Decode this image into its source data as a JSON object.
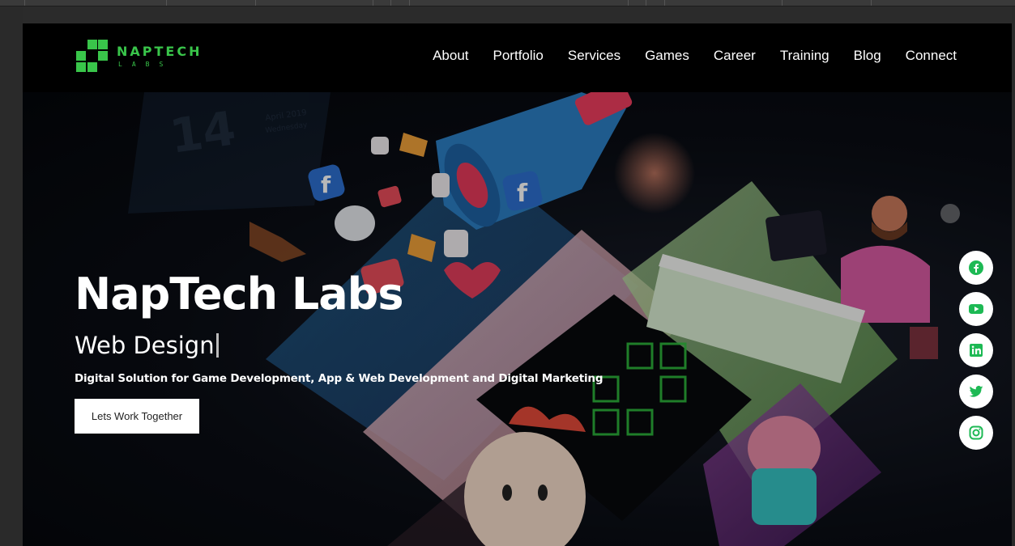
{
  "brand": {
    "name": "NAPTECH",
    "sub": "LABS",
    "color": "#39c54a"
  },
  "nav": {
    "items": [
      "About",
      "Portfolio",
      "Services",
      "Games",
      "Career",
      "Training",
      "Blog",
      "Connect"
    ]
  },
  "hero": {
    "title": "NapTech Labs",
    "typed_text": "Web Design",
    "description": "Digital Solution for Game Development, App & Web Development and Digital Marketing",
    "cta_label": "Lets Work Together"
  },
  "social": {
    "items": [
      "facebook-icon",
      "youtube-icon",
      "linkedin-icon",
      "twitter-icon",
      "instagram-icon"
    ],
    "icon_color": "#1db954"
  },
  "art": {
    "calendar_day": "14",
    "calendar_month": "April 2019",
    "calendar_weekday": "Wednesday"
  }
}
